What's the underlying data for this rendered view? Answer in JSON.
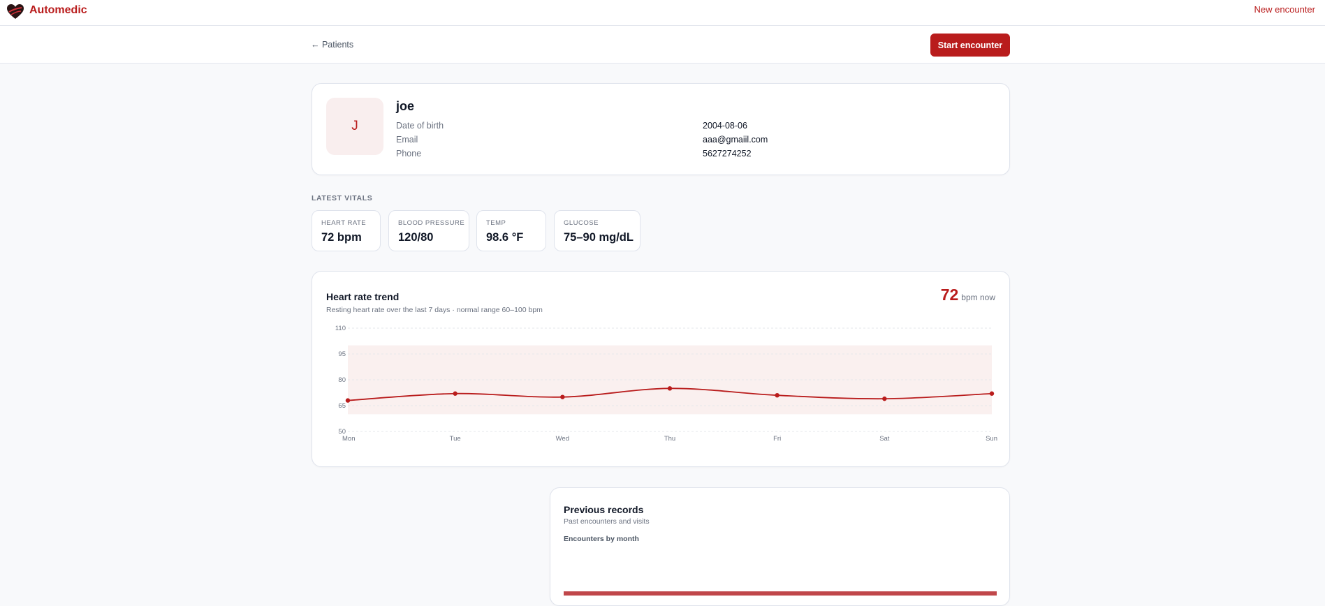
{
  "header": {
    "brand": "Automedic",
    "new_encounter": "New encounter"
  },
  "subbar": {
    "back_link": "← Patients",
    "start_button": "Start encounter"
  },
  "patient": {
    "initial": "J",
    "name": "joe",
    "fields": [
      {
        "label": "Date of birth",
        "value": "2004-08-06"
      },
      {
        "label": "Email",
        "value": "aaa@gmaiil.com"
      },
      {
        "label": "Phone",
        "value": "5627274252"
      }
    ]
  },
  "vitals": {
    "title": "LATEST VITALS",
    "items": [
      {
        "label": "HEART RATE",
        "value": "72 bpm"
      },
      {
        "label": "BLOOD PRESSURE",
        "value": "120/80"
      },
      {
        "label": "TEMP",
        "value": "98.6 °F"
      },
      {
        "label": "GLUCOSE",
        "value": "75–90 mg/dL"
      }
    ]
  },
  "heart_trend": {
    "title": "Heart rate trend",
    "subtitle": "Resting heart rate over the last 7 days · normal range 60–100 bpm",
    "now_value": "72",
    "now_unit": "bpm now"
  },
  "chart_data": {
    "type": "line",
    "title": "Heart rate trend",
    "categories": [
      "Mon",
      "Tue",
      "Wed",
      "Thu",
      "Fri",
      "Sat",
      "Sun"
    ],
    "series": [
      {
        "name": "Resting heart rate (bpm)",
        "values": [
          68,
          72,
          70,
          75,
          71,
          69,
          72
        ]
      }
    ],
    "yticks": [
      "110",
      "95",
      "80",
      "65",
      "50"
    ],
    "ylim": [
      50,
      110
    ],
    "normal_range": [
      60,
      100
    ],
    "grid": true,
    "line_color": "#b91c1c",
    "band_color": "#faf0ef"
  },
  "records": {
    "title": "Previous records",
    "subtitle": "Past encounters and visits",
    "chart_label": "Encounters by month"
  }
}
